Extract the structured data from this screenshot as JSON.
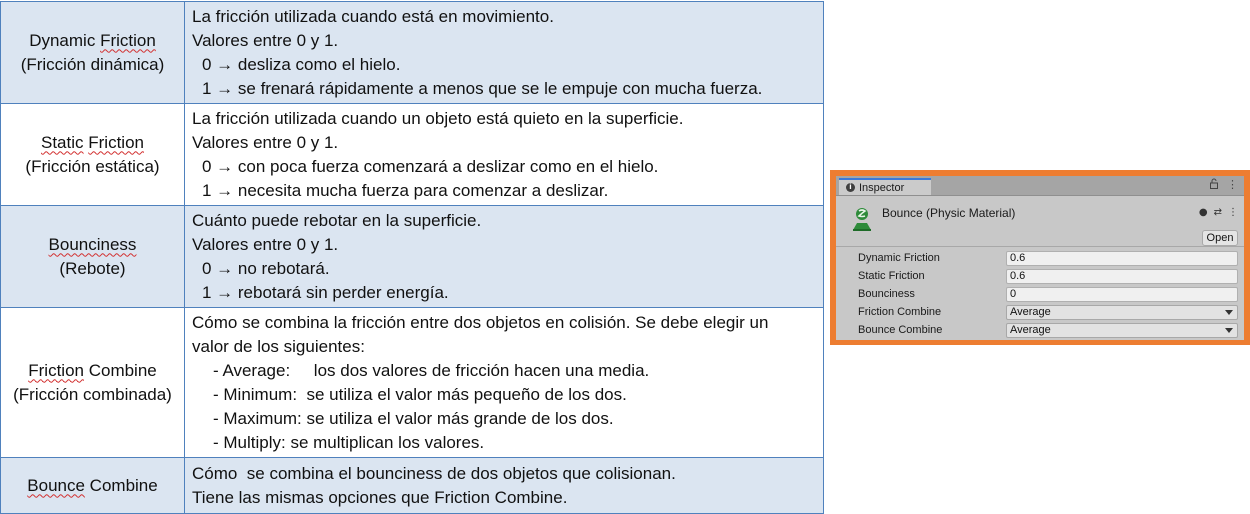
{
  "table": {
    "rows": [
      {
        "name_parts": [
          {
            "a": "Dynamic ",
            "b": "Friction"
          },
          {
            "a": "(Fricción dinámica)"
          }
        ],
        "desc": [
          "La fricción utilizada cuando está en movimiento.",
          "Valores entre 0 y 1.",
          "0 → desliza como el hielo.",
          "1 → se frenará rápidamente a menos que se le empuje con mucha fuerza."
        ]
      },
      {
        "name_parts": [
          {
            "a": "Static",
            "b": "Friction"
          },
          {
            "a": "(Fricción estática)"
          }
        ],
        "desc": [
          "La fricción utilizada cuando un objeto está quieto en la superficie.",
          "Valores entre 0 y 1.",
          "0 → con poca fuerza comenzará a deslizar como en el hielo.",
          "1 → necesita mucha fuerza para comenzar a deslizar."
        ]
      },
      {
        "name_parts": [
          {
            "a": "Bounciness"
          },
          {
            "a": "(Rebote)"
          }
        ],
        "desc": [
          "Cuánto puede rebotar en la superficie.",
          "Valores entre 0 y 1.",
          "0 → no rebotará.",
          "1 → rebotará sin perder energía."
        ]
      },
      {
        "name_parts": [
          {
            "a": "Friction",
            "b": " Combine"
          },
          {
            "a": "(Fricción combinada)"
          }
        ],
        "desc": [
          "Cómo se combina la fricción entre dos objetos en colisión. Se debe elegir un",
          "valor de los siguientes:",
          "- Average:     los dos valores de fricción hacen una media.",
          "- Minimum:  se utiliza el valor más pequeño de los dos.",
          "- Maximum: se utiliza el valor más grande de los dos.",
          "- Multiply: se multiplican los valores."
        ]
      },
      {
        "name_parts": [
          {
            "a": "Bounce",
            "b": " Combine"
          }
        ],
        "desc": [
          "Cómo  se combina el bounciness de dos objetos que colisionan.",
          "Tiene las mismas opciones que Friction Combine."
        ]
      }
    ]
  },
  "inspector": {
    "tab_label": "Inspector",
    "lock_icon": "lock-icon",
    "menu_icon": "kebab-menu-icon",
    "asset_title": "Bounce (Physic Material)",
    "help_icon": "help-icon",
    "presets_icon": "presets-icon",
    "open_label": "Open",
    "accent_color": "#ed7d31",
    "properties": [
      {
        "label": "Dynamic Friction",
        "value": "0.6",
        "kind": "field"
      },
      {
        "label": "Static Friction",
        "value": "0.6",
        "kind": "field"
      },
      {
        "label": "Bounciness",
        "value": "0",
        "kind": "field"
      },
      {
        "label": "Friction Combine",
        "value": "Average",
        "kind": "select"
      },
      {
        "label": "Bounce Combine",
        "value": "Average",
        "kind": "select"
      }
    ]
  }
}
